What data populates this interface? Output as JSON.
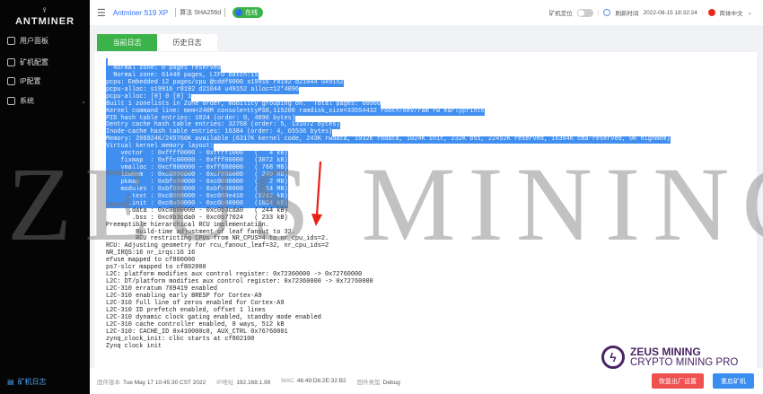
{
  "sidebar": {
    "logo": "ANTMINER",
    "items": [
      {
        "label": "用户面板"
      },
      {
        "label": "矿机配置"
      },
      {
        "label": "IP配置"
      },
      {
        "label": "系统"
      }
    ],
    "bottom_label": "矿机日志"
  },
  "header": {
    "model": "Antminer S19 XP",
    "algorithm": "算法 SHA256d",
    "status": "在线",
    "locate_label": "矿机定位",
    "locate_on": false,
    "refresh_label": "刷新时间",
    "refresh_time": "2022-08-15 18:32:24",
    "language": "简体中文"
  },
  "tabs": [
    {
      "label": "当前日志",
      "active": true
    },
    {
      "label": "历史日志",
      "active": false
    }
  ],
  "log": {
    "selected_count": 21,
    "lines": [
      "",
      "  Normal zone: 0 pages reserved",
      "  Normal zone: 61440 pages, LIFO batch:15",
      "pcpu: Embedded 12 pages/cpu @cddf0000 s19916 r8192 d21044 u49152",
      "pcpu-alloc: s19916 r8192 d21044 u49152 alloc=12*4096",
      "pcpu-alloc: [0] 0 [0] 1",
      "Built 1 zonelists in Zone order, mobility grouping on.  Total pages: 60960",
      "Kernel command line: mem=240M console=ttyPS0,115200 ramdisk_size=33554432 root=/dev/ram rw earlyprintk",
      "PID hash table entries: 1024 (order: 0, 4096 bytes)",
      "Dentry cache hash table entries: 32768 (order: 5, 131072 bytes)",
      "Inode-cache hash table entries: 16384 (order: 4, 65536 bytes)",
      "Memory: 206924K/245760K available (6317K kernel code, 243K rwdata, 1932K rodata, 1024K init, 232K bss, 22452K reserved, 16384K cma-reserved, 0K highmem)",
      "Virtual kernel memory layout:",
      "    vector  : 0xffff0000 - 0xffff1000   (   4 kB)",
      "    fixmap  : 0xffc00000 - 0xfff00000   (3072 kB)",
      "    vmalloc : 0xcf800000 - 0xff800000   ( 768 MB)",
      "    lowmem  : 0xc0000000 - 0xcf000000   ( 240 MB)",
      "    pkmap   : 0xbfe00000 - 0xc0000000   (   2 MB)",
      "    modules : 0xbf000000 - 0xbfe00000   (  14 MB)",
      "      .text : 0xc0008000 - 0xc090e410   (9242 kB)",
      "      .init : 0xc0a00000 - 0xc0b00000   (1024 kB)",
      "      .data : 0xc0b00000 - 0xc0b3cda0   ( 244 kB)",
      "       .bss : 0xc0b3cda0 - 0xc0b77024   ( 233 kB)",
      "Preemptible hierarchical RCU implementation.",
      "        Build-time adjustment of leaf fanout to 32.",
      "        RCU restricting CPUs from NR_CPUS=4 to nr_cpu_ids=2.",
      "RCU: Adjusting geometry for rcu_fanout_leaf=32, nr_cpu_ids=2",
      "NR_IRQS:16 nr_irqs:16 16",
      "efuse mapped to cf800000",
      "ps7-slcr mapped to cf802000",
      "L2C: platform modifies aux control register: 0x72360000 -> 0x72760000",
      "L2C: DT/platform modifies aux control register: 0x72360000 -> 0x72760000",
      "L2C-310 erratum 769419 enabled",
      "L2C-310 enabling early BRESP for Cortex-A9",
      "L2C-310 full line of zeros enabled for Cortex-A9",
      "L2C-310 ID prefetch enabled, offset 1 lines",
      "L2C-310 dynamic clock gating enabled, standby mode enabled",
      "L2C-310 cache controller enabled, 8 ways, 512 kB",
      "L2C-310: CACHE_ID 0x410000c8, AUX_CTRL 0x76760001",
      "zynq_clock_init: clkc starts at cf802100",
      "Zynq clock init"
    ]
  },
  "footer": {
    "firmware_label": "固件版本",
    "firmware": "Tue May 17 10:45:30 CST 2022",
    "ip_label": "IP地址",
    "ip": "192.168.1.99",
    "mac_label": "MAC",
    "mac": "46:49:D6:2E:32:B2",
    "type_label": "固件类型",
    "type": "Debug",
    "reset_label": "恢复出厂设置",
    "reboot_label": "重启矿机"
  },
  "watermark": "ZEUS MINING",
  "brand": {
    "line1": "ZEUS MINING",
    "line2": "CRYPTO MINING PRO"
  },
  "colors": {
    "sidebar": "#050505",
    "accent_green": "#3cb34a",
    "accent_blue": "#3a8ef0",
    "danger": "#f05050",
    "selection": "#3f8ef0",
    "annotation_arrow": "#e8201a",
    "brand": "#4a2466"
  }
}
